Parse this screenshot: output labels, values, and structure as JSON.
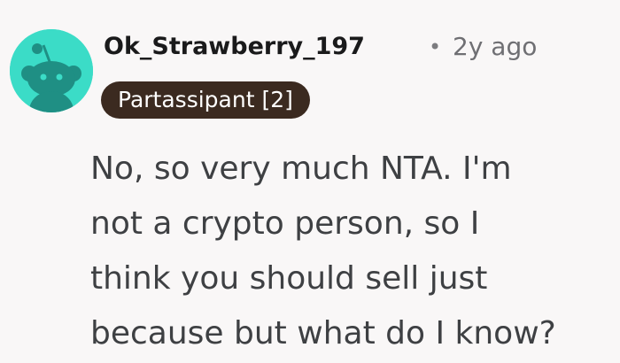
{
  "comment": {
    "username": "Ok_Strawberry_197",
    "separator": "•",
    "timestamp": "2y ago",
    "flair": "Partassipant [2]",
    "body_lines": [
      "No, so very much NTA. I'm",
      "not a crypto person, so I",
      "think you should sell just",
      "because but what do I know?"
    ],
    "avatar": {
      "icon": "reddit-snoo-avatar-icon",
      "background_color": "#3bdcc7"
    }
  }
}
